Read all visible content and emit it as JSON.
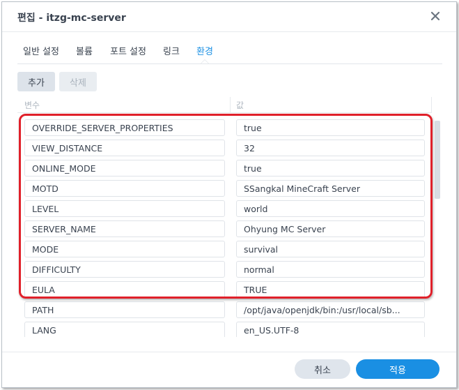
{
  "dialog": {
    "title": "편집 - itzg-mc-server"
  },
  "tabs": [
    {
      "label": "일반 설정",
      "active": false
    },
    {
      "label": "볼륨",
      "active": false
    },
    {
      "label": "포트 설정",
      "active": false
    },
    {
      "label": "링크",
      "active": false
    },
    {
      "label": "환경",
      "active": true
    }
  ],
  "toolbar": {
    "add_label": "추가",
    "delete_label": "삭제"
  },
  "table": {
    "headers": {
      "variable": "변수",
      "value": "값"
    },
    "rows": [
      {
        "variable": "OVERRIDE_SERVER_PROPERTIES",
        "value": "true"
      },
      {
        "variable": "VIEW_DISTANCE",
        "value": "32"
      },
      {
        "variable": "ONLINE_MODE",
        "value": "true"
      },
      {
        "variable": "MOTD",
        "value": "SSangkal MineCraft Server"
      },
      {
        "variable": "LEVEL",
        "value": "world"
      },
      {
        "variable": "SERVER_NAME",
        "value": "Ohyung MC Server"
      },
      {
        "variable": "MODE",
        "value": "survival"
      },
      {
        "variable": "DIFFICULTY",
        "value": "normal"
      },
      {
        "variable": "EULA",
        "value": "TRUE"
      },
      {
        "variable": "PATH",
        "value": "/opt/java/openjdk/bin:/usr/local/sb..."
      },
      {
        "variable": "LANG",
        "value": "en_US.UTF-8"
      }
    ]
  },
  "footer": {
    "cancel_label": "취소",
    "apply_label": "적용"
  },
  "colors": {
    "accent": "#1a8fe3",
    "highlight": "#e0202a"
  },
  "icons": {
    "close": "close-icon"
  }
}
